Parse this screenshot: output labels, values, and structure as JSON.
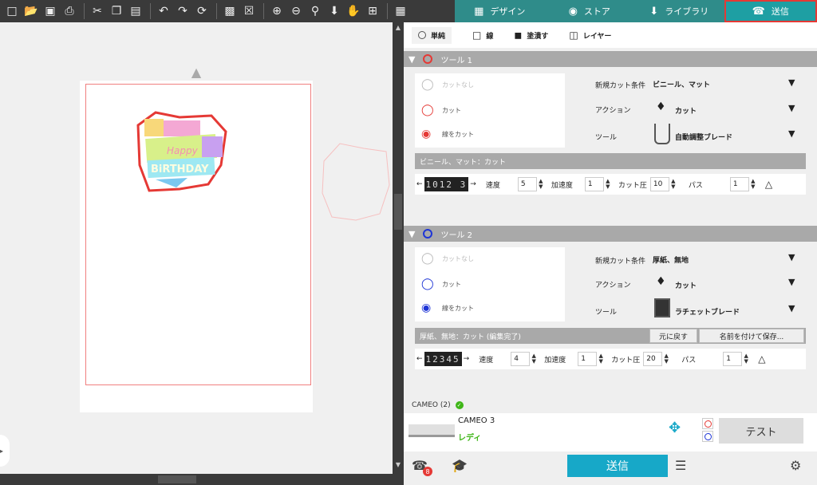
{
  "toolbar": {
    "icons": [
      "new-icon",
      "open-icon",
      "save-icon",
      "print-icon",
      "cut-icon",
      "copy-icon",
      "paste-icon",
      "undo-icon",
      "redo-icon",
      "refresh-icon",
      "group-icon",
      "ungroup-icon",
      "zoom-in-icon",
      "zoom-out-icon",
      "zoom-fit-icon",
      "move-down-icon",
      "pan-icon",
      "add-icon",
      "grid-icon"
    ]
  },
  "tabs": {
    "design": "デザイン",
    "store": "ストア",
    "library": "ライブラリ",
    "send": "送信"
  },
  "subtabs": {
    "simple": "単純",
    "line": "線",
    "fill": "塗潰す",
    "layer": "レイヤー"
  },
  "tool1": {
    "header": "ツール 1",
    "color": "#e53935",
    "actions": [
      "カットなし",
      "カット",
      "線をカット"
    ],
    "new_condition_label": "新規カット条件",
    "new_condition_value": "ビニール、マット",
    "action_label": "アクション",
    "action_value": "カット",
    "tool_label": "ツール",
    "tool_value": "自動調整ブレード",
    "setting_name": "ビニール、マット：カット",
    "blade_seq": "1012 3",
    "speed_label": "速度",
    "speed": "5",
    "accel_label": "加速度",
    "accel": "1",
    "pressure_label": "カット圧",
    "pressure": "10",
    "pass_label": "パス",
    "pass": "1"
  },
  "tool2": {
    "header": "ツール 2",
    "color": "#1e35d6",
    "actions": [
      "カットなし",
      "カット",
      "線をカット"
    ],
    "new_condition_label": "新規カット条件",
    "new_condition_value": "厚紙、無地",
    "action_label": "アクション",
    "action_value": "カット",
    "tool_label": "ツール",
    "tool_value": "ラチェットブレード",
    "setting_name": "厚紙、無地：カット (編集完了)",
    "revert_label": "元に戻す",
    "save_as_label": "名前を付けて保存...",
    "blade_seq": "12345",
    "speed_label": "速度",
    "speed": "4",
    "accel_label": "加速度",
    "accel": "1",
    "pressure_label": "カット圧",
    "pressure": "20",
    "pass_label": "パス",
    "pass": "1"
  },
  "device": {
    "header": "CAMEO (2)",
    "model": "CAMEO 3",
    "status": "レディ",
    "status_color": "#3fb618",
    "test_label": "テスト"
  },
  "bottom": {
    "send_label": "送信",
    "badge_count": "8"
  },
  "artwork": {
    "line1": "Happy",
    "line2": "BiRTHDAY"
  }
}
